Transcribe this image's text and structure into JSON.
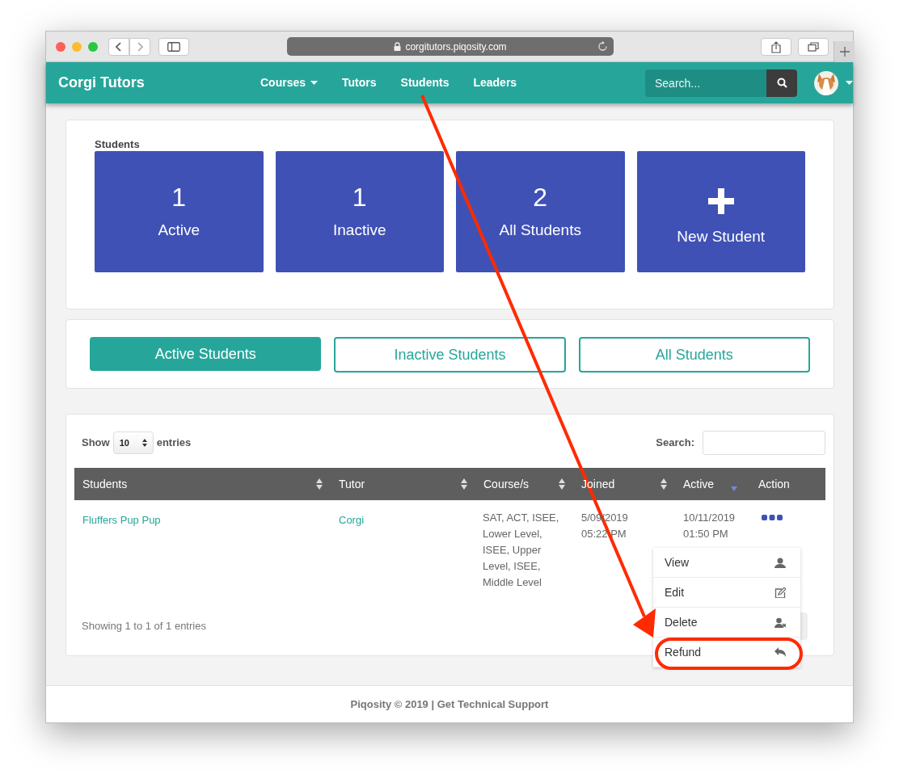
{
  "browser": {
    "url": "corgitutors.piqosity.com"
  },
  "navbar": {
    "brand": "Corgi Tutors",
    "links": [
      {
        "label": "Courses",
        "dropdown": true
      },
      {
        "label": "Tutors",
        "dropdown": false
      },
      {
        "label": "Students",
        "dropdown": false
      },
      {
        "label": "Leaders",
        "dropdown": false
      }
    ],
    "search": {
      "placeholder": "Search..."
    }
  },
  "summary": {
    "title": "Students",
    "tiles": [
      {
        "kind": "count",
        "value": "1",
        "label": "Active"
      },
      {
        "kind": "count",
        "value": "1",
        "label": "Inactive"
      },
      {
        "kind": "count",
        "value": "2",
        "label": "All Students"
      },
      {
        "kind": "add",
        "label": "New Student"
      }
    ]
  },
  "filters": [
    {
      "label": "Active Students",
      "selected": true
    },
    {
      "label": "Inactive Students",
      "selected": false
    },
    {
      "label": "All Students",
      "selected": false
    }
  ],
  "table": {
    "show_label": "Show",
    "page_length": "10",
    "entries_label": "entries",
    "search_label": "Search:",
    "columns": [
      {
        "label": "Students",
        "kind": "sortable"
      },
      {
        "label": "Tutor",
        "kind": "sortable"
      },
      {
        "label": "Course/s",
        "kind": "sortable"
      },
      {
        "label": "Joined",
        "kind": "sortable"
      },
      {
        "label": "Active",
        "kind": "sorted-descending"
      },
      {
        "label": "Action",
        "kind": "plain"
      }
    ],
    "rows": [
      {
        "student": "Fluffers Pup Pup",
        "tutor": "Corgi",
        "courses": "SAT, ACT, ISEE, Lower Level, ISEE, Upper Level, ISEE, Middle Level",
        "joined": "5/09/2019\n05:22 PM",
        "active": "10/11/2019\n01:50 PM"
      }
    ],
    "action_menu": [
      {
        "label": "View",
        "kind": "user"
      },
      {
        "label": "Edit",
        "kind": "edit"
      },
      {
        "label": "Delete",
        "kind": "remove"
      },
      {
        "label": "Refund",
        "kind": "reply"
      }
    ],
    "info": "Showing 1 to 1 of 1 entries"
  },
  "footer": "Piqosity © 2019 | Get Technical Support"
}
